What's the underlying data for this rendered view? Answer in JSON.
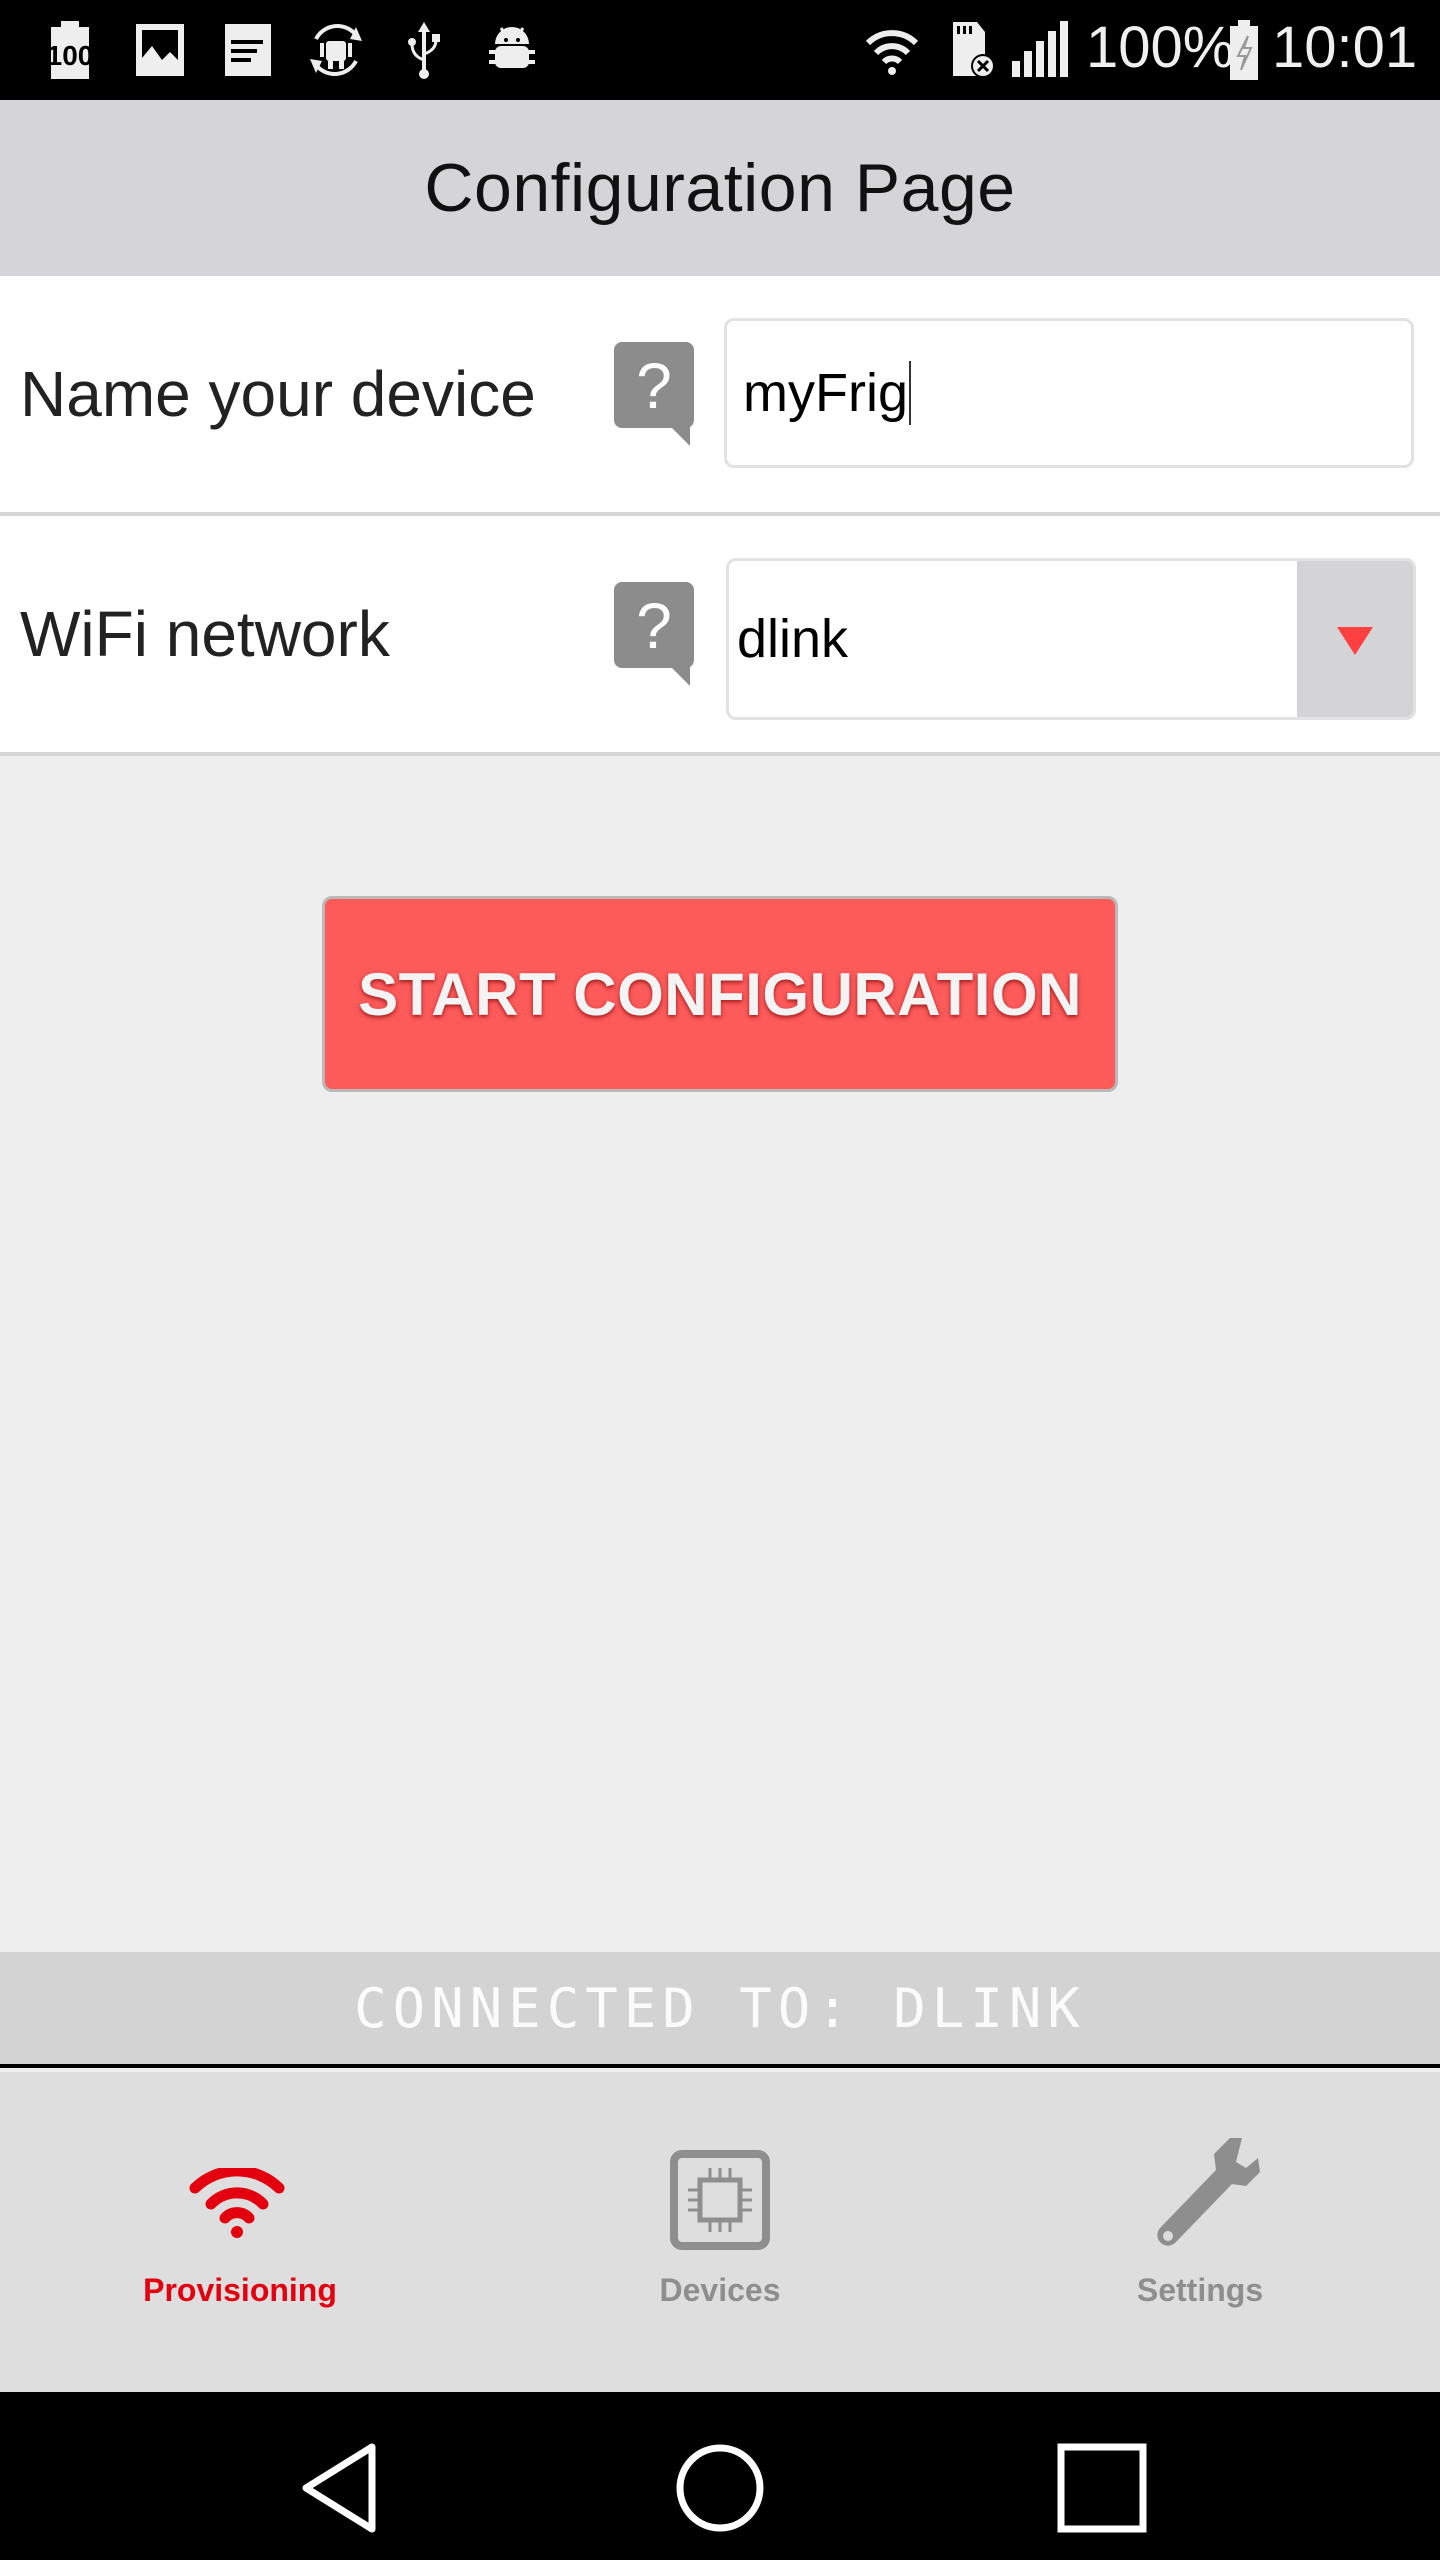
{
  "status_bar": {
    "left_icons": [
      "battery-100-notification-icon",
      "image-icon",
      "document-icon",
      "android-sync-icon",
      "usb-icon",
      "android-debug-icon"
    ],
    "right_icons": [
      "wifi-icon",
      "sd-card-error-icon",
      "cell-signal-icon"
    ],
    "battery_percent": "100%",
    "battery_icon": "battery-charging-icon",
    "time": "10:01"
  },
  "header": {
    "title": "Configuration Page"
  },
  "form": {
    "device_name": {
      "label": "Name your device",
      "value": "myFrig",
      "help_icon": "help-question-icon"
    },
    "wifi_network": {
      "label": "WiFi network",
      "selected": "dlink",
      "help_icon": "help-question-icon",
      "dropdown_icon": "triangle-down-icon"
    }
  },
  "actions": {
    "start_label": "START CONFIGURATION"
  },
  "connection": {
    "status_text": "CONNECTED TO: DLINK"
  },
  "tabs": [
    {
      "label": "Provisioning",
      "icon": "wifi-icon",
      "active": true
    },
    {
      "label": "Devices",
      "icon": "chip-icon",
      "active": false
    },
    {
      "label": "Settings",
      "icon": "wrench-icon",
      "active": false
    }
  ],
  "colors": {
    "accent": "#e3000f",
    "button": "#fd5a5a",
    "inactive_tab": "#8e8e8e",
    "dropdown_arrow": "#ff4040"
  },
  "nav_bar": {
    "buttons": [
      "back-icon",
      "home-icon",
      "recents-icon"
    ]
  }
}
